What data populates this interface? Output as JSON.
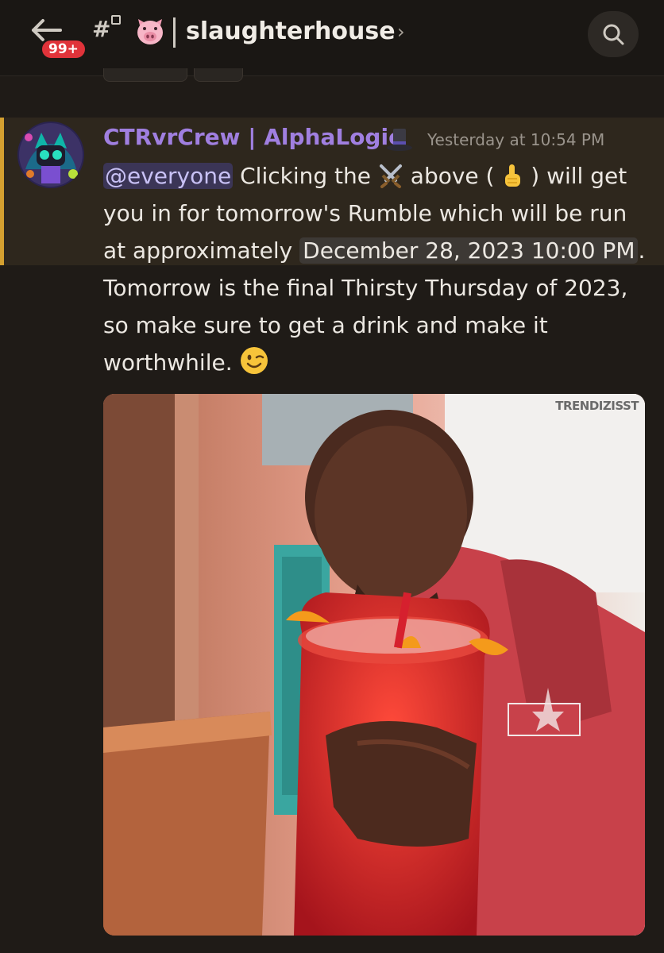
{
  "header": {
    "unread_badge": "99+",
    "channel_symbol": "#",
    "channel_name": "slaughterhouse",
    "chevron": "›",
    "icons": {
      "back": "arrow-left-icon",
      "search": "search-icon",
      "channel": "hashtag-icon",
      "lock": "lock-icon",
      "pig": "pig-face-emoji"
    }
  },
  "message": {
    "author": "CTRvrCrew | AlphaLogic",
    "author_color": "#a07fe0",
    "timestamp": "Yesterday at 10:54 PM",
    "mention": "@everyone",
    "line1_a": " Clicking the ",
    "line1_b": " above ( ",
    "line1_c": " ) will get",
    "line2": "you in for tomorrow's Rumble which will be run",
    "line3_a": "at approximately ",
    "date": "December 28, 2023 10:00 PM",
    "line3_b": ".",
    "line4": "Tomorrow is the final Thirsty Thursday of 2023,",
    "line5": "so make sure to get a drink and make it",
    "line6": "worthwhile. ",
    "highlight_color": "#d4a030",
    "emojis": [
      "crossed-swords-icon",
      "pointing-up-icon",
      "winking-face-icon",
      "top-hat-icon"
    ]
  },
  "attachment": {
    "watermark": "TRENDIZISST"
  }
}
